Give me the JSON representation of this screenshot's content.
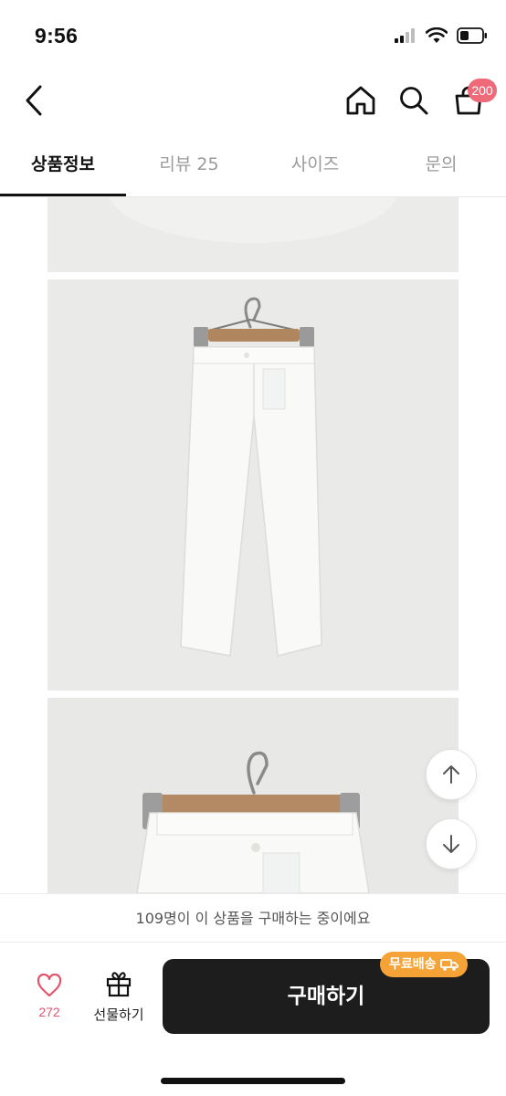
{
  "status": {
    "time": "9:56",
    "icons": [
      "signal-icon",
      "wifi-icon",
      "battery-icon"
    ]
  },
  "header": {
    "icons": [
      "back-icon",
      "home-icon",
      "search-icon",
      "cart-icon"
    ],
    "cart_badge": "200"
  },
  "tabs": [
    {
      "label": "상품정보",
      "active": true
    },
    {
      "label": "리뷰 25",
      "active": false
    },
    {
      "label": "사이즈",
      "active": false
    },
    {
      "label": "문의",
      "active": false
    }
  ],
  "content": {
    "images": [
      "product-photo-top-crop",
      "product-photo-pants-on-hanger",
      "product-photo-pants-closeup"
    ]
  },
  "scroll_buttons": {
    "icons": [
      "arrow-up-icon",
      "arrow-down-icon"
    ]
  },
  "notice": "109명이 이 상품을 구매하는 중이에요",
  "bottom": {
    "like_count": "272",
    "gift_label": "선물하기",
    "buy_label": "구매하기",
    "free_shipping": "무료배송"
  },
  "colors": {
    "accent_pink": "#ee6a78",
    "like_red": "#e2546a",
    "buy_button": "#1d1d1d",
    "free_shipping_orange": "#f5a236"
  }
}
